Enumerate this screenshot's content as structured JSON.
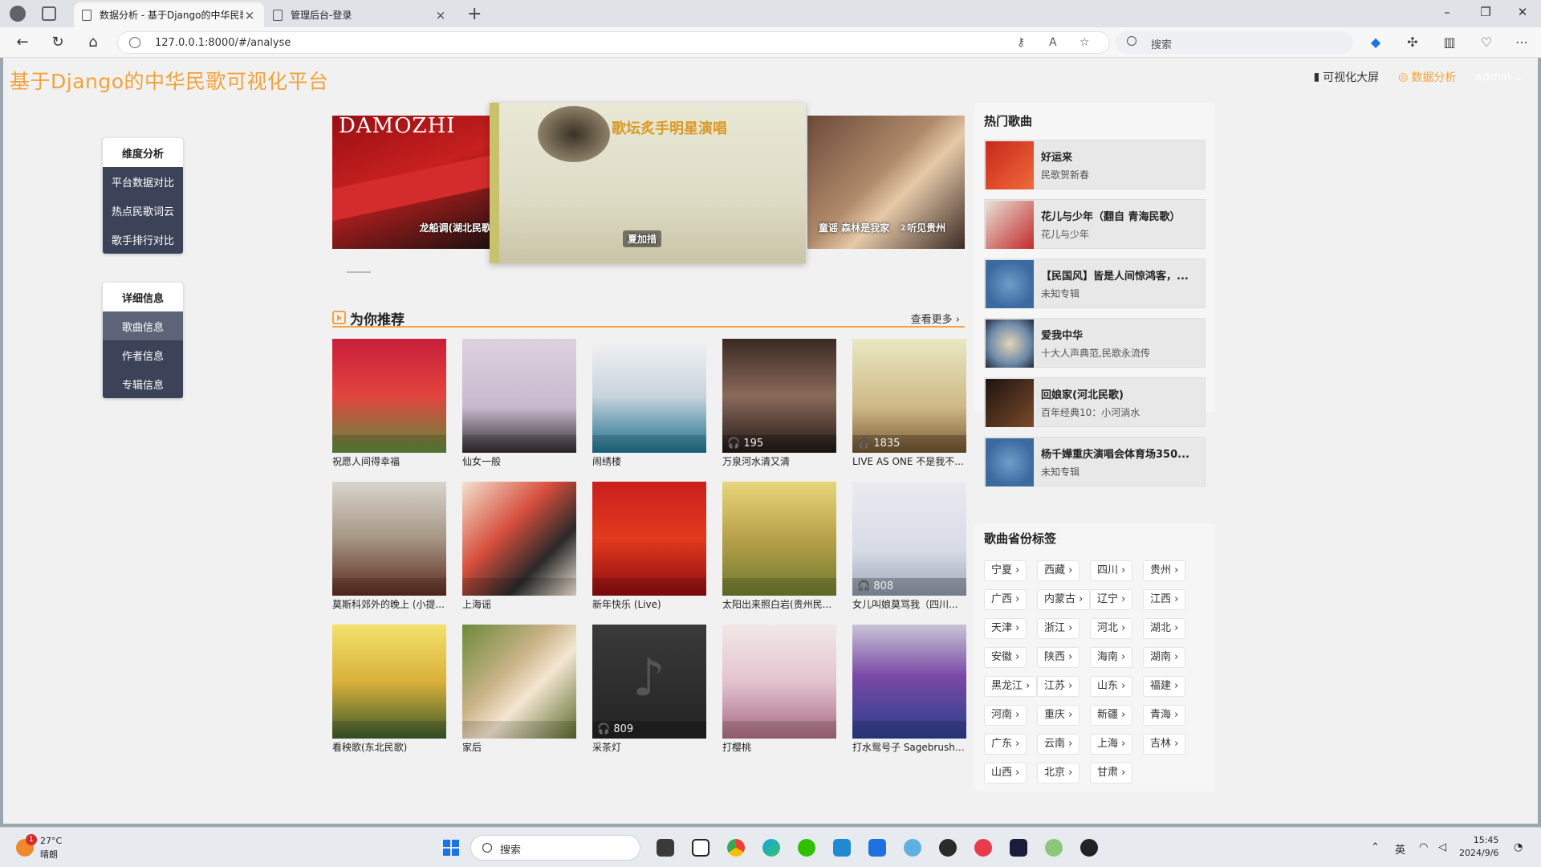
{
  "browser": {
    "tabs": [
      {
        "title": "数据分析 - 基于Django的中华民歌可视化平台",
        "close": "×"
      },
      {
        "title": "管理后台-登录",
        "close": "×"
      }
    ],
    "new_tab": "+",
    "url": "127.0.0.1:8000/#/analyse",
    "search_placeholder": "搜索",
    "window_controls": {
      "minimize": "–",
      "restore": "❐",
      "close": "✕"
    }
  },
  "app": {
    "brand": "基于Django的中华民歌可视化平台",
    "nav": {
      "screen": "可视化大屏",
      "analyse": "数据分析",
      "user": "admin"
    }
  },
  "sidebar": {
    "dimension": {
      "heading": "维度分析",
      "items": [
        "平台数据对比",
        "热点民歌词云",
        "歌手排行对比"
      ]
    },
    "detail": {
      "heading": "详细信息",
      "items": [
        "歌曲信息",
        "作者信息",
        "专辑信息"
      ]
    }
  },
  "carousel": {
    "slides": [
      {
        "caption": "龙船调(湖北民歌",
        "banner_text": "DAMOZHI"
      },
      {
        "caption": "夏加措",
        "banner_text": "歌坛炙手明星演唱"
      },
      {
        "caption": "童谣 森林是我家",
        "banner_text": ""
      },
      {
        "caption": "②听见贵州",
        "banner_text": ""
      }
    ]
  },
  "recommend": {
    "title": "为你推荐",
    "more": "查看更多 ›",
    "items": [
      {
        "name": "祝愿人间得幸福",
        "count": ""
      },
      {
        "name": "仙女一般",
        "count": ""
      },
      {
        "name": "闹绣楼",
        "count": ""
      },
      {
        "name": "万泉河水清又清",
        "count": "195"
      },
      {
        "name": "LIVE AS ONE 不是我不...",
        "count": "1835"
      },
      {
        "name": "莫斯科郊外的晚上 (小提...",
        "count": ""
      },
      {
        "name": "上海谣",
        "count": ""
      },
      {
        "name": "新年快乐 (Live)",
        "count": ""
      },
      {
        "name": "太阳出来照白岩(贵州民...",
        "count": ""
      },
      {
        "name": "女儿叫娘莫骂我（四川...",
        "count": "808"
      },
      {
        "name": "看秧歌(东北民歌)",
        "count": ""
      },
      {
        "name": "家后",
        "count": ""
      },
      {
        "name": "采茶灯",
        "count": "809"
      },
      {
        "name": "打樱桃",
        "count": ""
      },
      {
        "name": "打水鸳号子 Sagebrush ...",
        "count": ""
      }
    ]
  },
  "hot_songs": {
    "title": "热门歌曲",
    "items": [
      {
        "name": "好运来",
        "album": "民歌贺新春"
      },
      {
        "name": "花儿与少年（翻自 青海民歌）",
        "album": "花儿与少年"
      },
      {
        "name": "【民国风】皆是人间惊鸿客，...",
        "album": "未知专辑"
      },
      {
        "name": "爱我中华",
        "album": "十大人声典范,民歌永流传"
      },
      {
        "name": "回娘家(河北民歌)",
        "album": "百年经典10：小河淌水"
      },
      {
        "name": "杨千嬅重庆演唱会体育场350...",
        "album": "未知专辑"
      }
    ]
  },
  "province_tags": {
    "title": "歌曲省份标签",
    "items": [
      "宁夏 ›",
      "西藏 ›",
      "四川 ›",
      "贵州 ›",
      "广西 ›",
      "内蒙古 ›",
      "辽宁 ›",
      "江西 ›",
      "天津 ›",
      "浙江 ›",
      "河北 ›",
      "湖北 ›",
      "安徽 ›",
      "陕西 ›",
      "海南 ›",
      "湖南 ›",
      "黑龙江 ›",
      "江苏 ›",
      "山东 ›",
      "福建 ›",
      "河南 ›",
      "重庆 ›",
      "新疆 ›",
      "青海 ›",
      "广东 ›",
      "云南 ›",
      "上海 ›",
      "吉林 ›",
      "山西 ›",
      "北京 ›",
      "甘肃 ›"
    ]
  },
  "taskbar": {
    "weather_temp": "27°C",
    "weather_desc": "晴朗",
    "weather_badge": "1",
    "search_placeholder": "搜索",
    "ime": "英",
    "time": "15:45",
    "date": "2024/9/6"
  },
  "colors": {
    "accent": "#f1a33c",
    "sidebar": "#3c4358"
  }
}
